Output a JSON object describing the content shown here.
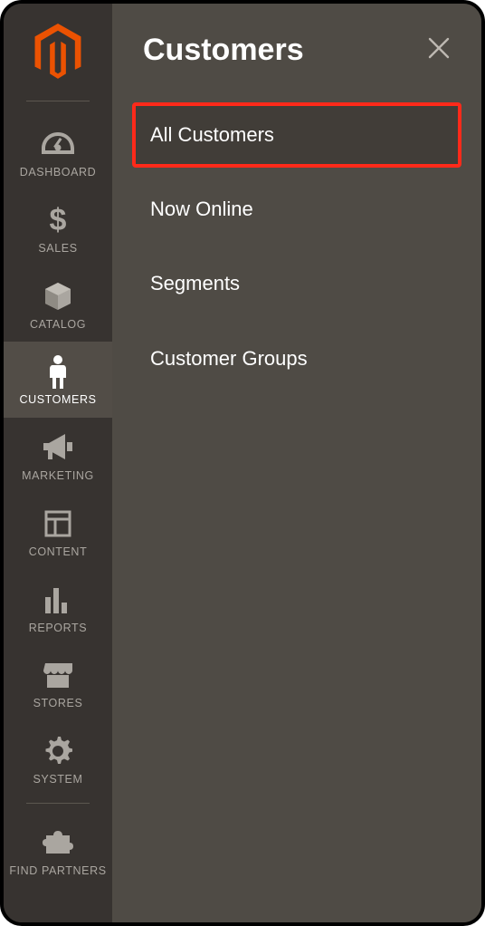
{
  "panel": {
    "title": "Customers",
    "items": [
      {
        "label": "All Customers",
        "highlight": true
      },
      {
        "label": "Now Online",
        "highlight": false
      },
      {
        "label": "Segments",
        "highlight": false
      },
      {
        "label": "Customer Groups",
        "highlight": false
      }
    ]
  },
  "sidebar": {
    "items": [
      {
        "label": "DASHBOARD"
      },
      {
        "label": "SALES"
      },
      {
        "label": "CATALOG"
      },
      {
        "label": "CUSTOMERS"
      },
      {
        "label": "MARKETING"
      },
      {
        "label": "CONTENT"
      },
      {
        "label": "REPORTS"
      },
      {
        "label": "STORES"
      },
      {
        "label": "SYSTEM"
      },
      {
        "label": "FIND PARTNERS"
      }
    ],
    "active_index": 3
  },
  "icons": {
    "logo": "magento-logo-icon",
    "close": "close-icon"
  }
}
